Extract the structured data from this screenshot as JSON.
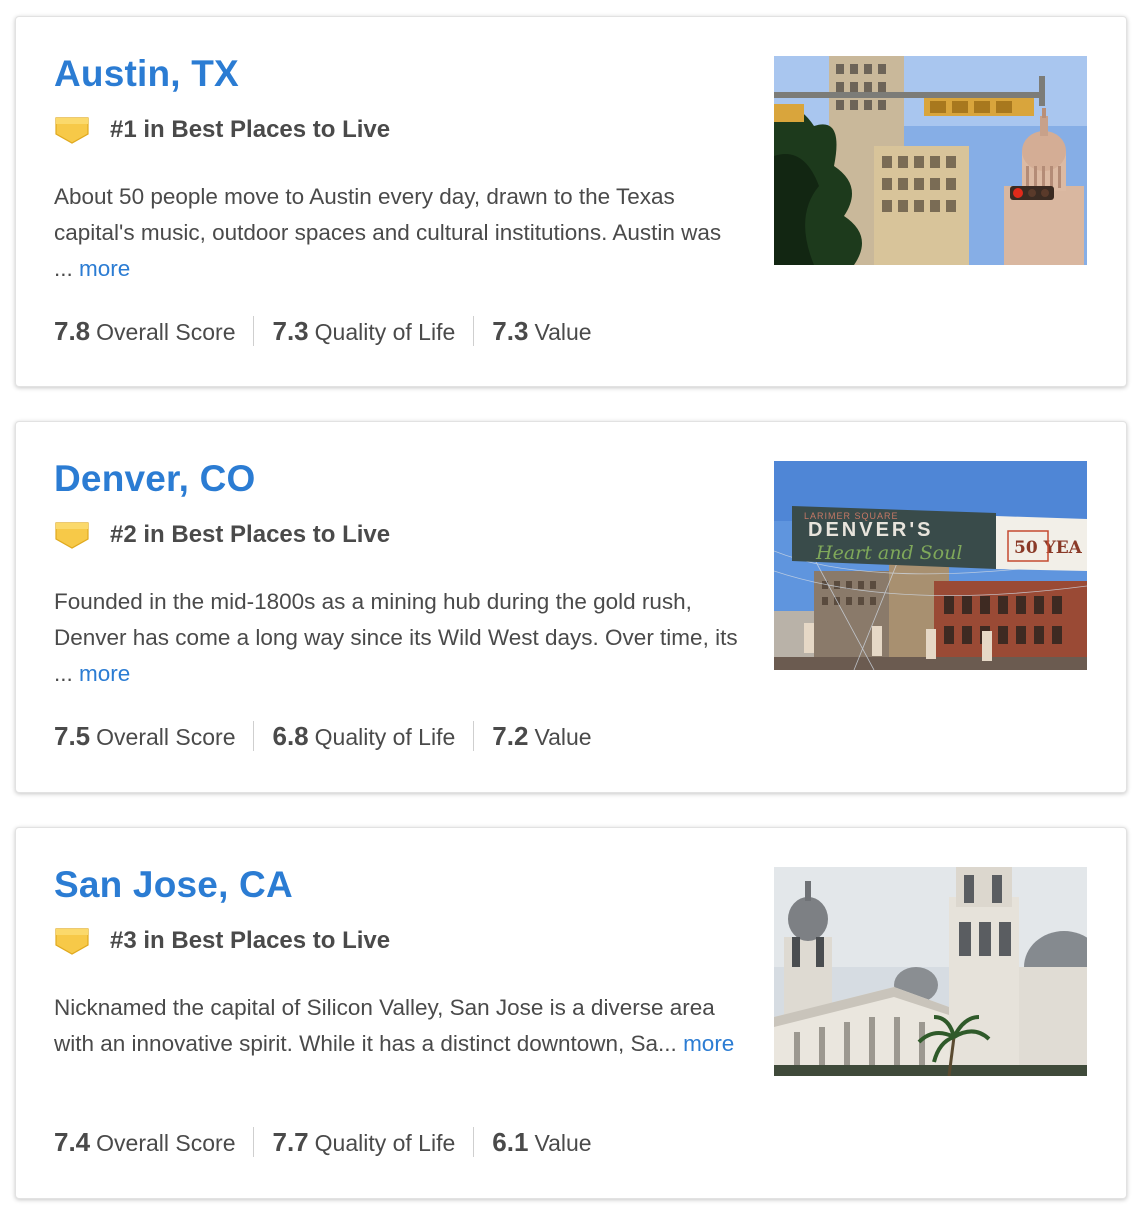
{
  "cities": [
    {
      "name": "Austin, TX",
      "rank_text": "#1 in Best Places to Live",
      "description": "About 50 people move to Austin every day, drawn to the Texas capital's music, outdoor spaces and cultural institutions. Austin was ...",
      "more_label": "more",
      "overall_score": "7.8",
      "overall_label": "Overall Score",
      "quality_score": "7.3",
      "quality_label": "Quality of Life",
      "value_score": "7.3",
      "value_label": "Value",
      "photo_icon": "austin-capitol-photo"
    },
    {
      "name": "Denver, CO",
      "rank_text": "#2 in Best Places to Live",
      "description": "Founded in the mid-1800s as a mining hub during the gold rush, Denver has come a long way since its Wild West days. Over time, its ...",
      "more_label": "more",
      "overall_score": "7.5",
      "overall_label": "Overall Score",
      "quality_score": "6.8",
      "quality_label": "Quality of Life",
      "value_score": "7.2",
      "value_label": "Value",
      "photo_icon": "denver-larimer-square-photo",
      "photo_banner": {
        "top": "LARIMER SQUARE",
        "main": "DENVER'S",
        "script": "Heart and Soul",
        "side": "50 YEA"
      }
    },
    {
      "name": "San Jose, CA",
      "rank_text": "#3 in Best Places to Live",
      "description": "Nicknamed the capital of Silicon Valley, San Jose is a diverse area with an innovative spirit. While it has a distinct downtown, Sa...",
      "more_label": "more",
      "overall_score": "7.4",
      "overall_label": "Overall Score",
      "quality_score": "7.7",
      "quality_label": "Quality of Life",
      "value_score": "6.1",
      "value_label": "Value",
      "photo_icon": "san-jose-cathedral-photo"
    }
  ],
  "colors": {
    "link": "#2b7cd3",
    "text": "#4a4a4a",
    "badge": "#f7c948",
    "divider": "#cfcfcf"
  },
  "icons": {
    "rank_badge": "shield-badge-icon"
  }
}
